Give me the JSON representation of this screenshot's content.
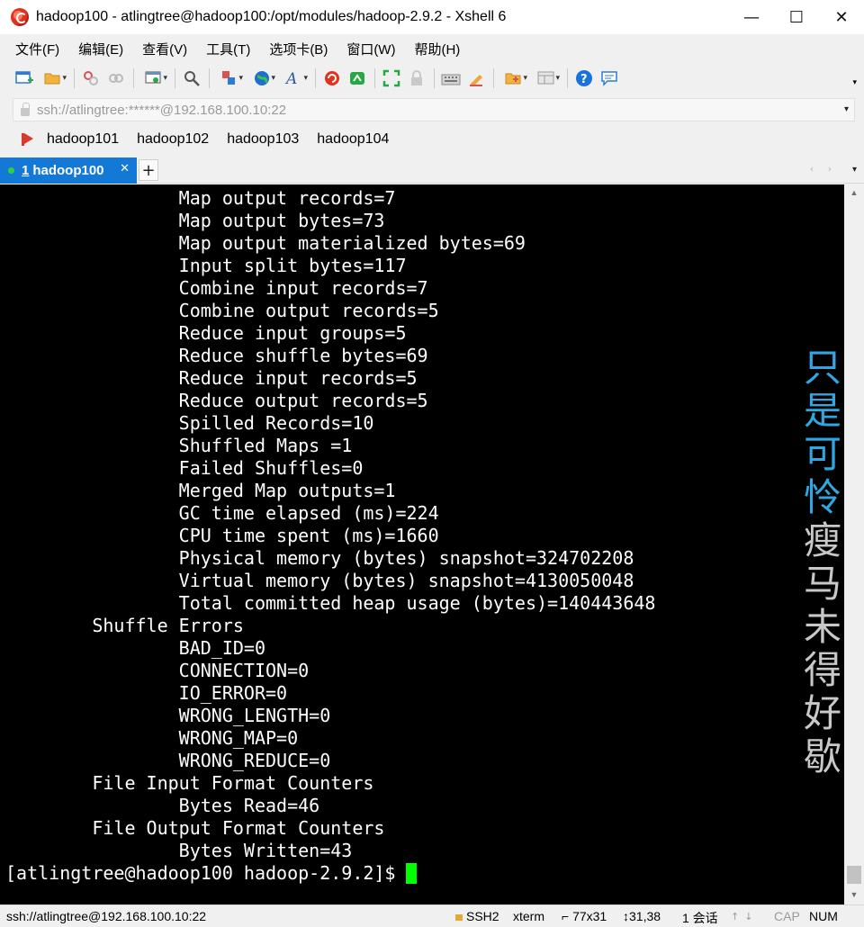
{
  "window": {
    "title": "hadoop100 - atlingtree@hadoop100:/opt/modules/hadoop-2.9.2 - Xshell 6",
    "minimize": "—",
    "maximize": "☐",
    "close": "✕"
  },
  "menu": {
    "items": [
      "文件(F)",
      "编辑(E)",
      "查看(V)",
      "工具(T)",
      "选项卡(B)",
      "窗口(W)",
      "帮助(H)"
    ]
  },
  "toolbar": {
    "icons": [
      "new-session-icon",
      "open-folder-icon",
      "disconnect-icon",
      "reconnect-icon",
      "properties-icon",
      "find-icon",
      "transfer-icon",
      "globe-icon",
      "font-icon",
      "xshell-logo-icon",
      "xftp-icon",
      "fullscreen-icon",
      "lock-icon",
      "keyboard-icon",
      "highlighter-icon",
      "new-tab-folder-icon",
      "layout-icon",
      "help-icon",
      "chat-icon"
    ],
    "colors": {
      "help": "#1a73d9",
      "xshell": "#e0321e",
      "xftp": "#27a845",
      "globe": "#1f6fd1"
    }
  },
  "address": {
    "value": "ssh://atlingtree:******@192.168.100.10:22"
  },
  "quick_connect": {
    "items": [
      "hadoop101",
      "hadoop102",
      "hadoop103",
      "hadoop104"
    ]
  },
  "tabs": {
    "active": {
      "number": "1",
      "label": "hadoop100"
    },
    "add": "+",
    "nav": "‹ ›",
    "accent": "#1479d6"
  },
  "terminal": {
    "lines": [
      "                Map output records=7",
      "                Map output bytes=73",
      "                Map output materialized bytes=69",
      "                Input split bytes=117",
      "                Combine input records=7",
      "                Combine output records=5",
      "                Reduce input groups=5",
      "                Reduce shuffle bytes=69",
      "                Reduce input records=5",
      "                Reduce output records=5",
      "                Spilled Records=10",
      "                Shuffled Maps =1",
      "                Failed Shuffles=0",
      "                Merged Map outputs=1",
      "                GC time elapsed (ms)=224",
      "                CPU time spent (ms)=1660",
      "                Physical memory (bytes) snapshot=324702208",
      "                Virtual memory (bytes) snapshot=4130050048",
      "                Total committed heap usage (bytes)=140443648",
      "        Shuffle Errors",
      "                BAD_ID=0",
      "                CONNECTION=0",
      "                IO_ERROR=0",
      "                WRONG_LENGTH=0",
      "                WRONG_MAP=0",
      "                WRONG_REDUCE=0",
      "        File Input Format Counters",
      "                Bytes Read=46",
      "        File Output Format Counters",
      "                Bytes Written=43"
    ],
    "prompt": "[atlingtree@hadoop100 hadoop-2.9.2]$",
    "cursor_color": "#00ff00",
    "watermark_blue": "只是可怜",
    "watermark_gray": "瘦马未得好歇",
    "watermark_colors": {
      "blue": "#2fa7e2",
      "gray": "#c8c8c8"
    }
  },
  "status": {
    "connection": "ssh://atlingtree@192.168.100.10:22",
    "protocol": "SSH2",
    "terminal_type": "xterm",
    "size": "77x31",
    "position": "31,38",
    "sessions": "1 会话",
    "cap": "CAP",
    "num": "NUM"
  }
}
